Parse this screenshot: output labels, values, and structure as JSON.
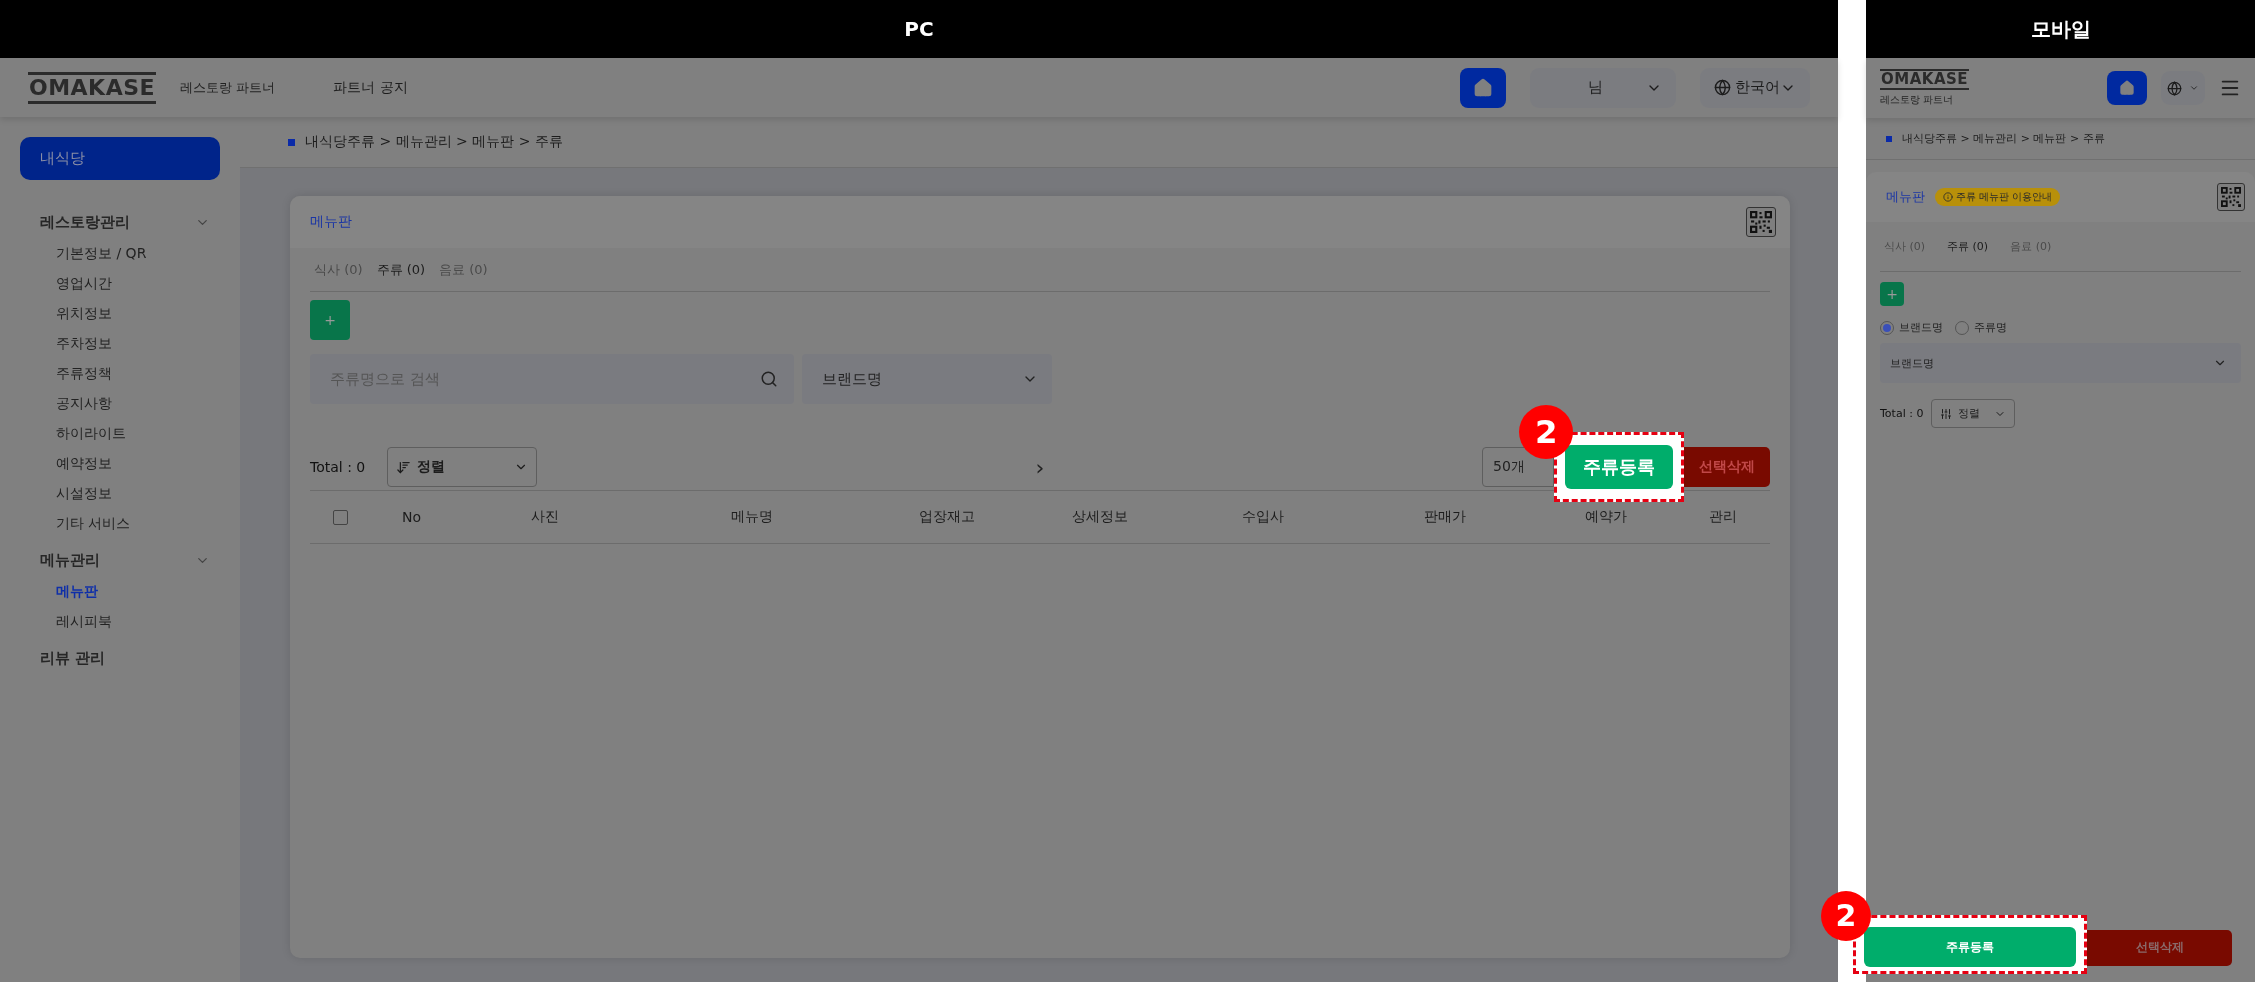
{
  "headers": {
    "pc": "PC",
    "mobile": "모바일"
  },
  "pc": {
    "logo": "OMAKASE",
    "logo_sub": "레스토랑 파트너",
    "nav": "파트너 공지",
    "user": "님",
    "language": "한국어",
    "sidebar": {
      "home": "내식당",
      "groups": [
        {
          "label": "레스토랑관리",
          "expanded": true,
          "children": [
            {
              "label": "기본정보 / QR",
              "selected": false
            },
            {
              "label": "영업시간",
              "selected": false
            },
            {
              "label": "위치정보",
              "selected": false
            },
            {
              "label": "주차정보",
              "selected": false
            },
            {
              "label": "주류정책",
              "selected": false
            },
            {
              "label": "공지사항",
              "selected": false
            },
            {
              "label": "하이라이트",
              "selected": false
            },
            {
              "label": "예약정보",
              "selected": false
            },
            {
              "label": "시설정보",
              "selected": false
            },
            {
              "label": "기타 서비스",
              "selected": false
            }
          ]
        },
        {
          "label": "메뉴관리",
          "expanded": true,
          "children": [
            {
              "label": "메뉴판",
              "selected": true
            },
            {
              "label": "레시피북",
              "selected": false
            }
          ]
        },
        {
          "label": "리뷰 관리"
        }
      ]
    },
    "breadcrumb": "내식당주류 > 메뉴관리 > 메뉴판 > 주류",
    "card": {
      "title": "메뉴판",
      "tabs": [
        {
          "label": "식사 (0)",
          "selected": false
        },
        {
          "label": "주류 (0)",
          "selected": true
        },
        {
          "label": "음료 (0)",
          "selected": false
        }
      ],
      "add": "+",
      "search_placeholder": "주류명으로 검색",
      "brand_select": "브랜드명",
      "total": "Total : 0",
      "sort": "정렬",
      "next": "›",
      "page_size": "50개",
      "register": {
        "label": "주류등록",
        "highlighted": true,
        "badge": "2"
      },
      "delete": "선택삭제",
      "select_all_checked": false,
      "columns": [
        "No",
        "사진",
        "메뉴명",
        "업장재고",
        "상세정보",
        "수입사",
        "판매가",
        "예약가",
        "관리"
      ]
    }
  },
  "mobile": {
    "logo": "OMAKASE",
    "logo_sub": "레스토랑 파트너",
    "breadcrumb": "내식당주류 > 메뉴관리 > 메뉴판 > 주류",
    "card": {
      "title": "메뉴판",
      "notice": "주류 메뉴판 이용안내",
      "tabs": [
        {
          "label": "식사 (0)",
          "selected": false
        },
        {
          "label": "주류 (0)",
          "selected": true
        },
        {
          "label": "음료 (0)",
          "selected": false
        }
      ],
      "add": "+",
      "radios": [
        {
          "label": "브랜드명",
          "selected": true
        },
        {
          "label": "주류명",
          "selected": false
        }
      ],
      "brand_select": "브랜드명",
      "total": "Total : 0",
      "sort": "정렬",
      "register": {
        "label": "주류등록",
        "highlighted": true,
        "badge": "2"
      },
      "delete": "선택삭제"
    }
  }
}
